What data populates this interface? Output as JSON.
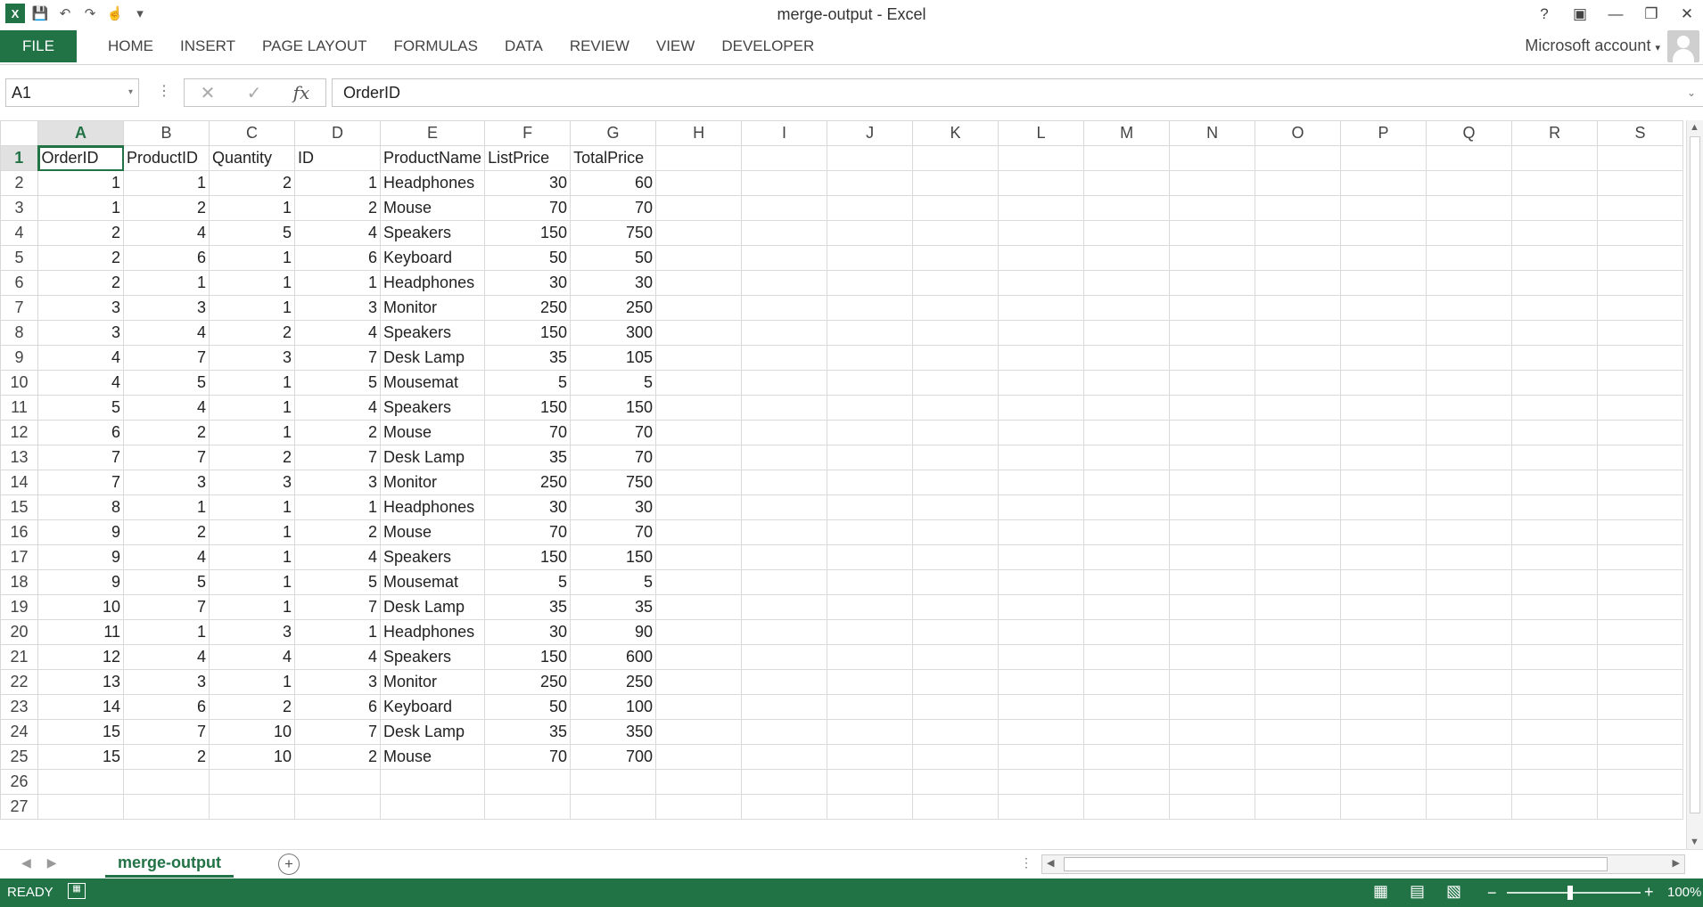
{
  "window": {
    "title": "merge-output - Excel",
    "help": "?"
  },
  "ribbon": {
    "file": "FILE",
    "tabs": [
      "HOME",
      "INSERT",
      "PAGE LAYOUT",
      "FORMULAS",
      "DATA",
      "REVIEW",
      "VIEW",
      "DEVELOPER"
    ],
    "account": "Microsoft account"
  },
  "formula_bar": {
    "name_box": "A1",
    "fx": "fx",
    "content": "OrderID"
  },
  "grid": {
    "columns": [
      "A",
      "B",
      "C",
      "D",
      "E",
      "F",
      "G",
      "H",
      "I",
      "J",
      "K",
      "L",
      "M",
      "N",
      "O",
      "P",
      "Q",
      "R",
      "S"
    ],
    "col_widths": [
      96,
      96,
      96,
      96,
      96,
      96,
      96,
      96,
      96,
      96,
      96,
      96,
      96,
      96,
      96,
      96,
      96,
      96,
      96
    ],
    "rows": [
      [
        "OrderID",
        "ProductID",
        "Quantity",
        "ID",
        "ProductName",
        "ListPrice",
        "TotalPrice"
      ],
      [
        "1",
        "1",
        "2",
        "1",
        "Headphones",
        "30",
        "60"
      ],
      [
        "1",
        "2",
        "1",
        "2",
        "Mouse",
        "70",
        "70"
      ],
      [
        "2",
        "4",
        "5",
        "4",
        "Speakers",
        "150",
        "750"
      ],
      [
        "2",
        "6",
        "1",
        "6",
        "Keyboard",
        "50",
        "50"
      ],
      [
        "2",
        "1",
        "1",
        "1",
        "Headphones",
        "30",
        "30"
      ],
      [
        "3",
        "3",
        "1",
        "3",
        "Monitor",
        "250",
        "250"
      ],
      [
        "3",
        "4",
        "2",
        "4",
        "Speakers",
        "150",
        "300"
      ],
      [
        "4",
        "7",
        "3",
        "7",
        "Desk Lamp",
        "35",
        "105"
      ],
      [
        "4",
        "5",
        "1",
        "5",
        "Mousemat",
        "5",
        "5"
      ],
      [
        "5",
        "4",
        "1",
        "4",
        "Speakers",
        "150",
        "150"
      ],
      [
        "6",
        "2",
        "1",
        "2",
        "Mouse",
        "70",
        "70"
      ],
      [
        "7",
        "7",
        "2",
        "7",
        "Desk Lamp",
        "35",
        "70"
      ],
      [
        "7",
        "3",
        "3",
        "3",
        "Monitor",
        "250",
        "750"
      ],
      [
        "8",
        "1",
        "1",
        "1",
        "Headphones",
        "30",
        "30"
      ],
      [
        "9",
        "2",
        "1",
        "2",
        "Mouse",
        "70",
        "70"
      ],
      [
        "9",
        "4",
        "1",
        "4",
        "Speakers",
        "150",
        "150"
      ],
      [
        "9",
        "5",
        "1",
        "5",
        "Mousemat",
        "5",
        "5"
      ],
      [
        "10",
        "7",
        "1",
        "7",
        "Desk Lamp",
        "35",
        "35"
      ],
      [
        "11",
        "1",
        "3",
        "1",
        "Headphones",
        "30",
        "90"
      ],
      [
        "12",
        "4",
        "4",
        "4",
        "Speakers",
        "150",
        "600"
      ],
      [
        "13",
        "3",
        "1",
        "3",
        "Monitor",
        "250",
        "250"
      ],
      [
        "14",
        "6",
        "2",
        "6",
        "Keyboard",
        "50",
        "100"
      ],
      [
        "15",
        "7",
        "10",
        "7",
        "Desk Lamp",
        "35",
        "350"
      ],
      [
        "15",
        "2",
        "10",
        "2",
        "Mouse",
        "70",
        "700"
      ],
      [],
      []
    ]
  },
  "sheets": {
    "active": "merge-output",
    "add": "+"
  },
  "status": {
    "ready": "READY",
    "zoom_minus": "−",
    "zoom_plus": "+",
    "zoom": "100%"
  }
}
